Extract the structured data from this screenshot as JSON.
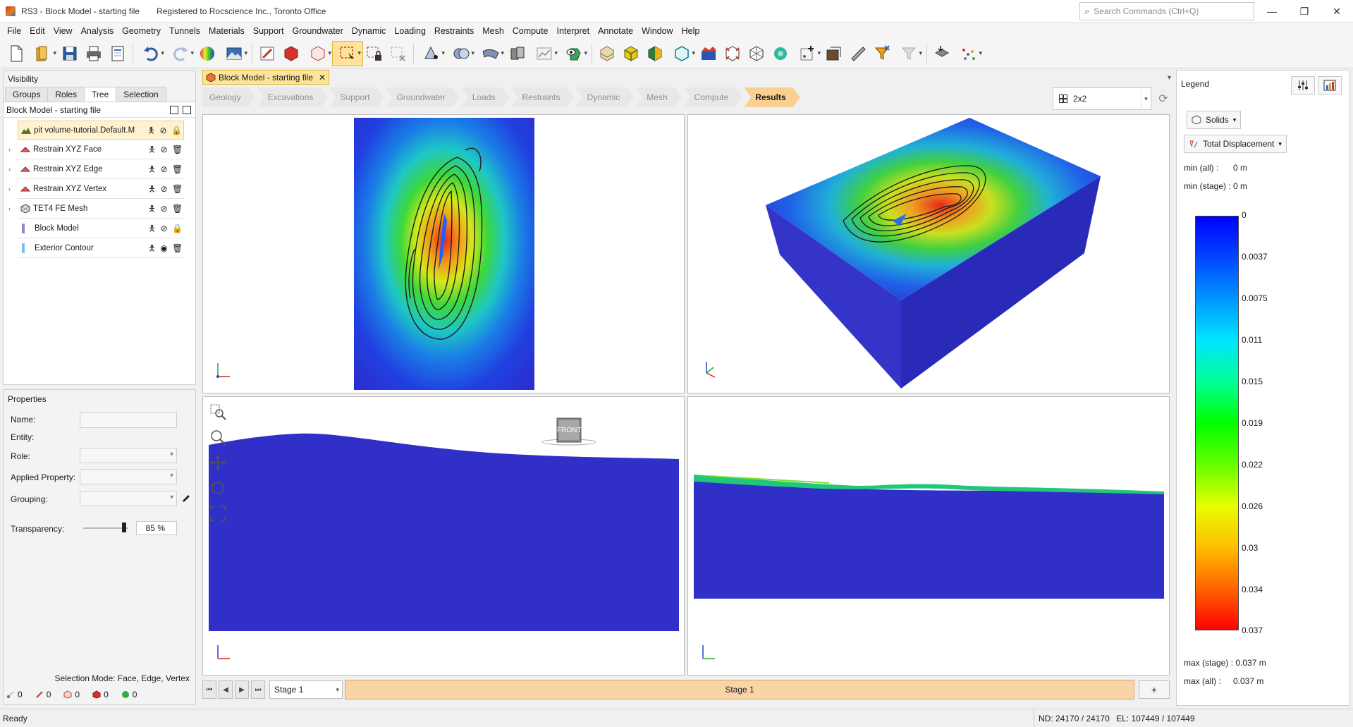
{
  "window": {
    "title": "RS3 - Block Model - starting file",
    "registration": "Registered to Rocscience Inc., Toronto Office",
    "search_placeholder": "Search Commands (Ctrl+Q)"
  },
  "menu": [
    "File",
    "Edit",
    "View",
    "Analysis",
    "Geometry",
    "Tunnels",
    "Materials",
    "Support",
    "Groundwater",
    "Dynamic",
    "Loading",
    "Restraints",
    "Mesh",
    "Compute",
    "Interpret",
    "Annotate",
    "Window",
    "Help"
  ],
  "visibility": {
    "title": "Visibility",
    "tabs": [
      "Groups",
      "Roles",
      "Tree",
      "Selection"
    ],
    "active_tab": "Tree",
    "tree_title": "Block Model - starting file",
    "items": [
      {
        "label": "pit volume-tutorial.Default.M",
        "icon": "terrain-icon",
        "lock": true
      },
      {
        "label": "Restrain XYZ Face",
        "icon": "restraint-icon",
        "lock": false
      },
      {
        "label": "Restrain XYZ Edge",
        "icon": "restraint-icon",
        "lock": false
      },
      {
        "label": "Restrain XYZ Vertex",
        "icon": "restraint-icon",
        "lock": false
      },
      {
        "label": "TET4 FE Mesh",
        "icon": "mesh-icon",
        "lock": false
      },
      {
        "label": "Block Model",
        "icon": "block-model-icon",
        "lock": true
      },
      {
        "label": "Exterior Contour",
        "icon": "contour-icon",
        "lock": false
      }
    ]
  },
  "properties": {
    "title": "Properties",
    "labels": {
      "name": "Name:",
      "entity": "Entity:",
      "role": "Role:",
      "applied_property": "Applied Property:",
      "grouping": "Grouping:",
      "transparency": "Transparency:"
    },
    "transparency_value": "85 %",
    "transparency_level": 0.85,
    "selection_mode": "Selection Mode: Face, Edge, Vertex",
    "counters": [
      "0",
      "0",
      "0",
      "0",
      "0"
    ]
  },
  "document": {
    "tab_label": "Block Model - starting file",
    "workflow": [
      "Geology",
      "Excavations",
      "Support",
      "Groundwater",
      "Loads",
      "Restraints",
      "Dynamic",
      "Mesh",
      "Compute",
      "Results"
    ],
    "active_step": "Results",
    "layout": "2x2",
    "front_label": "FRONT"
  },
  "stages": {
    "current": "Stage 1",
    "strip_label": "Stage 1",
    "add_label": "+"
  },
  "legend": {
    "title": "Legend",
    "mode": "Solids",
    "quantity": "Total Displacement",
    "min_all": "min (all) :",
    "min_all_value": "0 m",
    "min_stage": "min (stage) : 0 m",
    "ticks": [
      "0",
      "0.0037",
      "0.0075",
      "0.011",
      "0.015",
      "0.019",
      "0.022",
      "0.026",
      "0.03",
      "0.034",
      "0.037"
    ],
    "max_stage": "max (stage) : 0.037 m",
    "max_all": "max (all) :",
    "max_all_value": "0.037 m"
  },
  "status": {
    "left": "Ready",
    "nodes": "ND: 24170 / 24170",
    "elements": "EL: 107449 / 107449"
  },
  "colors": {
    "accent": "#fde49a",
    "active_step": "#f9d08f",
    "stage_strip": "#f9d4a6",
    "model_blue": "#3030c8"
  }
}
